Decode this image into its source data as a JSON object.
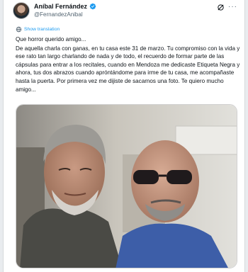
{
  "tweet": {
    "author_name": "Aníbal Fernández",
    "author_handle": "@FernandezAnibal",
    "show_translation": "Show translation",
    "text_lines": [
      "Que horror querido amigo...",
      "De aquella charla con ganas, en tu casa este 31 de marzo. Tu compromiso con la vida y ese rato tan largo charlando de nada y de todo, el recuerdo de formar parte de las cápsulas para entrar a los recitales, cuando en Mendoza me dedicaste Etiqueta Negra y ahora, tus dos abrazos cuando apróntándome para irme de tu casa, me acompañaste hasta la puerta. Por primera vez me dijiste de sacarnos una foto. Te quiero mucho amigo..."
    ]
  },
  "colors": {
    "link": "#1d9bf0",
    "verified_badge": "#1d9bf0",
    "text_primary": "#0f1419",
    "text_secondary": "#536471"
  },
  "icons": {
    "verified": "verified-badge-icon",
    "grok": "grok-icon",
    "more": "more-icon",
    "translate": "globe-icon"
  },
  "media": {
    "alt_description_shown": ""
  }
}
